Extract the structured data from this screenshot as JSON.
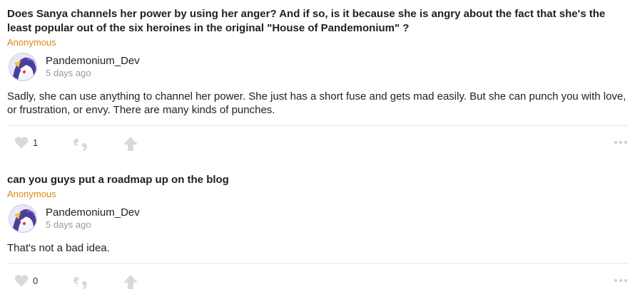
{
  "items": [
    {
      "question": "Does Sanya channels her power by using her anger? And if so, is it because she is angry about the fact that she's the least popular out of the six heroines in the original \"House of Pandemonium\" ?",
      "asker": "Anonymous",
      "author": "Pandemonium_Dev",
      "date": "5 days ago",
      "answer": "Sadly, she can use anything to channel her power. She just has a short fuse and gets mad easily. But she can punch you with love, or frustration, or envy. There are many kinds of punches.",
      "likes": "1"
    },
    {
      "question": "can you guys put a roadmap up on the blog",
      "asker": "Anonymous",
      "author": "Pandemonium_Dev",
      "date": "5 days ago",
      "answer": "That's not a bad idea.",
      "likes": "0"
    }
  ],
  "icons": {
    "like": "heart-icon",
    "quote": "quote-icon",
    "upvote": "upvote-arrow-icon",
    "more": "more-dots-icon"
  },
  "colors": {
    "asker": "#dc8a10",
    "icon": "#d9d9d9",
    "divider": "#e6e6e6"
  }
}
